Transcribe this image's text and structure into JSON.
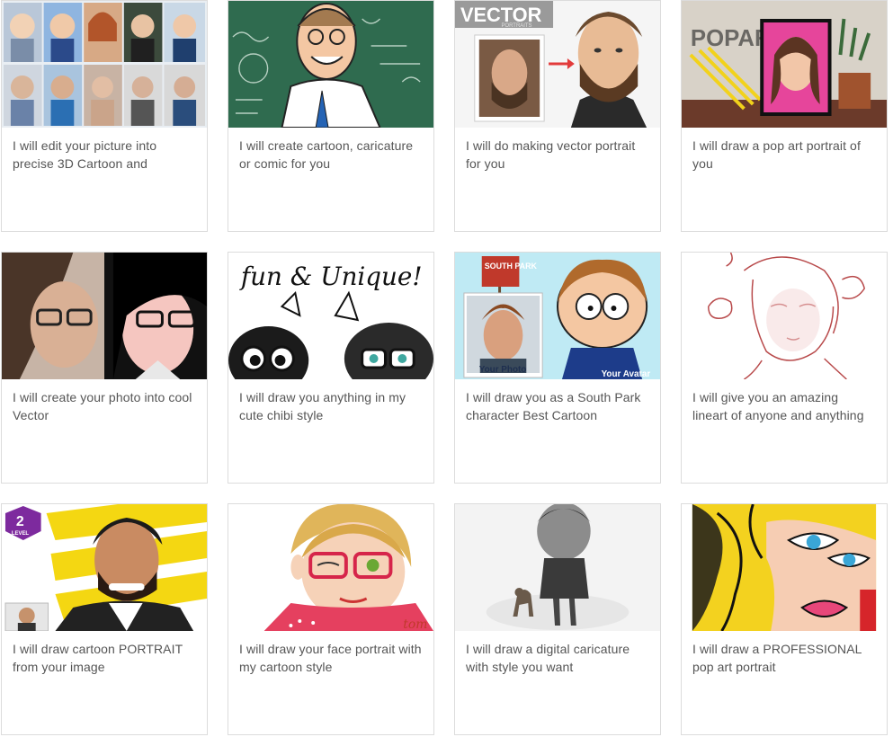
{
  "gigs": [
    {
      "title": "I will edit your picture into precise 3D Cartoon and"
    },
    {
      "title": "I will create cartoon, caricature or comic for you"
    },
    {
      "title": "I will do making vector portrait for you",
      "thumb_text": "VECTOR",
      "thumb_subtext": "PORTRAITS"
    },
    {
      "title": "I will draw a pop art portrait of you",
      "thumb_text": "POPART"
    },
    {
      "title": "I will create your photo into cool Vector"
    },
    {
      "title": "I will draw you anything in my cute chibi style",
      "thumb_text": "fun & Unique!"
    },
    {
      "title": "I will draw you as a South Park character Best Cartoon",
      "thumb_text": "SOUTH PARK",
      "label_left": "Your Photo",
      "label_right": "Your Avatar"
    },
    {
      "title": "I will give you an amazing lineart of anyone and anything"
    },
    {
      "title": "I will draw cartoon PORTRAIT from your image",
      "badge_number": "2",
      "badge_label": "LEVEL"
    },
    {
      "title": "I will draw your face portrait with my cartoon style",
      "thumb_text": "tom"
    },
    {
      "title": "I will draw a digital caricature with style you want"
    },
    {
      "title": "I will draw a PROFESSIONAL pop art portrait"
    }
  ],
  "colors": {
    "border": "#dcdcdc",
    "title_text": "#555555"
  }
}
